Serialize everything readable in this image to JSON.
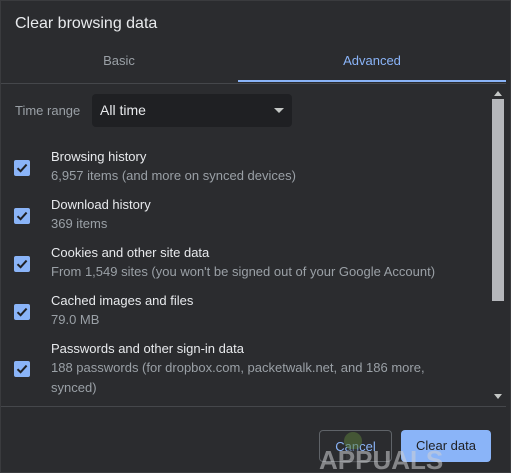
{
  "dialog": {
    "title": "Clear browsing data"
  },
  "tabs": [
    {
      "label": "Basic",
      "selected": false
    },
    {
      "label": "Advanced",
      "selected": true
    }
  ],
  "time_range": {
    "label": "Time range",
    "value": "All time"
  },
  "items": [
    {
      "title": "Browsing history",
      "description": "6,957 items (and more on synced devices)",
      "checked": true
    },
    {
      "title": "Download history",
      "description": "369 items",
      "checked": true
    },
    {
      "title": "Cookies and other site data",
      "description": "From 1,549 sites (you won't be signed out of your Google Account)",
      "checked": true
    },
    {
      "title": "Cached images and files",
      "description": "79.0 MB",
      "checked": true
    },
    {
      "title": "Passwords and other sign-in data",
      "description": "188 passwords (for dropbox.com, packetwalk.net, and 186 more, synced)",
      "checked": true
    }
  ],
  "buttons": {
    "cancel": "Cancel",
    "clear": "Clear data"
  },
  "watermark": {
    "text": "APPUALS"
  },
  "colors": {
    "background": "#2b2c2f",
    "accent": "#8ab4f8",
    "text_primary": "#e8eaed",
    "text_secondary": "#9aa0a6"
  }
}
